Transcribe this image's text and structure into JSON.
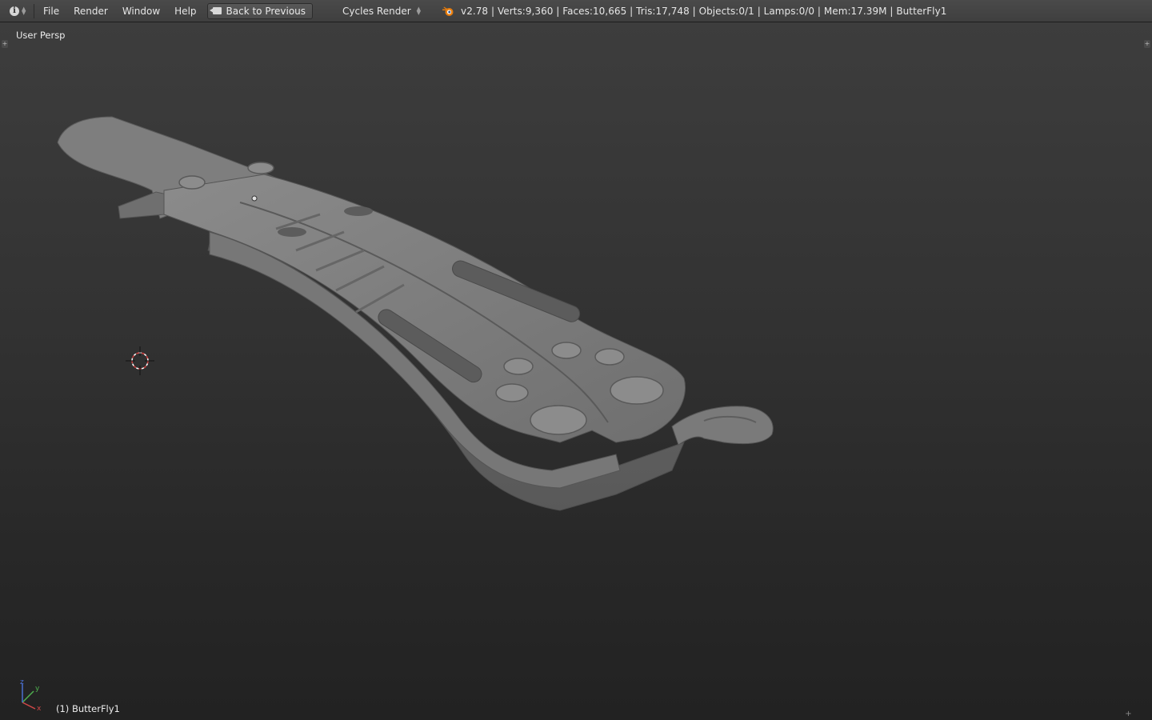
{
  "topbar": {
    "editor_icon": "info-icon",
    "menus": [
      "File",
      "Render",
      "Window",
      "Help"
    ],
    "back_button": "Back to Previous",
    "render_engine": "Cycles Render",
    "logo_icon": "blender-logo-icon",
    "stats": "v2.78 | Verts:9,360 | Faces:10,665 | Tris:17,748 | Objects:0/1 | Lamps:0/0 | Mem:17.39M | ButterFly1"
  },
  "viewport": {
    "view_name": "User Persp",
    "active_object": "(1) ButterFly1",
    "axis_labels": {
      "x": "x",
      "y": "y",
      "z": "z"
    },
    "colors": {
      "model": "#7a7a7a",
      "axis_x": "#d24848",
      "axis_y": "#4fb04f",
      "axis_z": "#4a6fd0"
    }
  }
}
